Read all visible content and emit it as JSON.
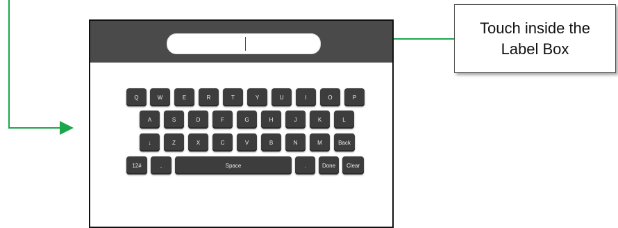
{
  "callout": {
    "text": "Touch inside the Label Box"
  },
  "keyboard": {
    "row1": [
      "Q",
      "W",
      "E",
      "R",
      "T",
      "Y",
      "U",
      "I",
      "O",
      "P"
    ],
    "row2": [
      "A",
      "S",
      "D",
      "F",
      "G",
      "H",
      "J",
      "K",
      "L"
    ],
    "row3": [
      "↓",
      "Z",
      "X",
      "C",
      "V",
      "B",
      "N",
      "M",
      "Back"
    ],
    "row4": [
      "12#",
      ",",
      "Space",
      ".",
      "Done",
      "Clear"
    ]
  },
  "colors": {
    "arrow": "#1aa64a",
    "topbar": "#4a4a4a",
    "key": "#3d3d3d"
  },
  "icons": {
    "down-arrow": "↓"
  }
}
